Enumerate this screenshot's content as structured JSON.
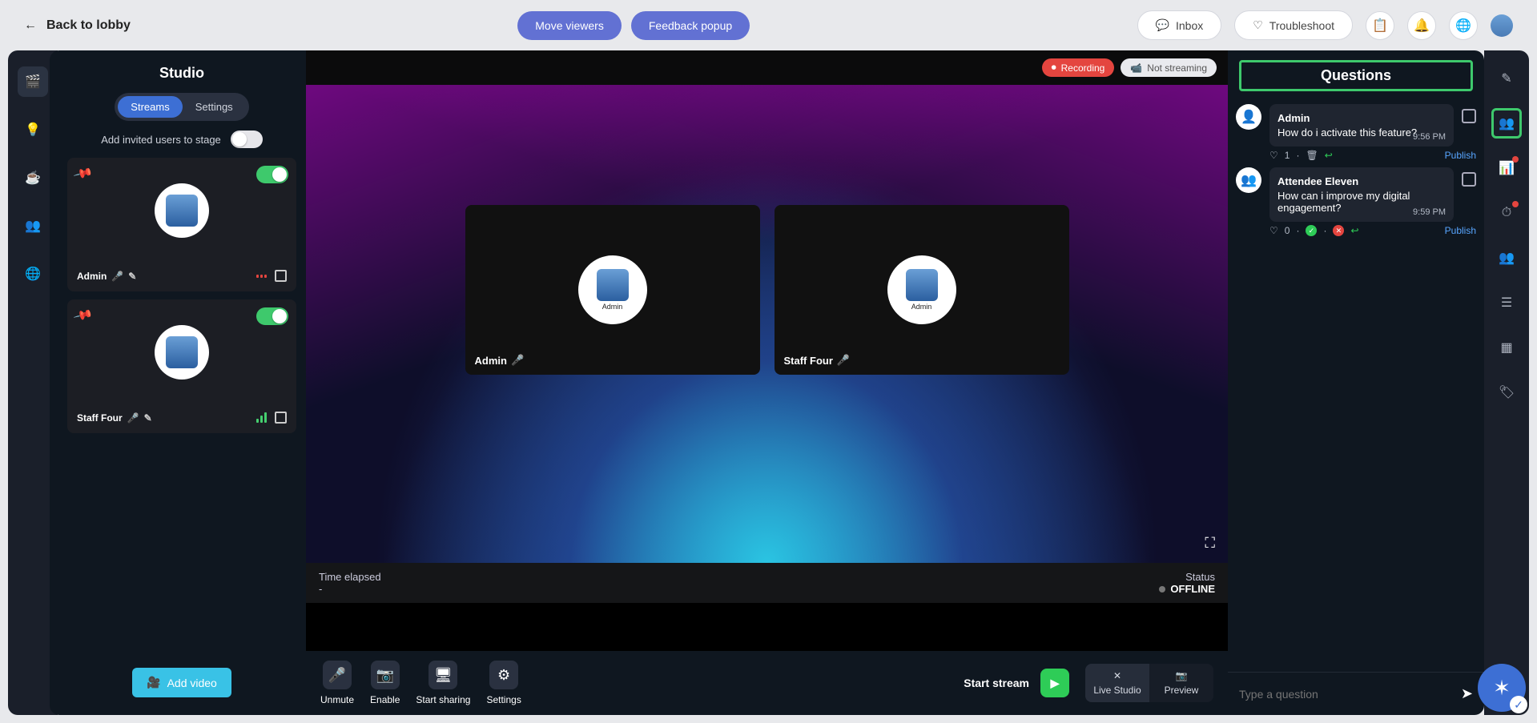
{
  "header": {
    "back_label": "Back to lobby",
    "move_viewers": "Move viewers",
    "feedback_popup": "Feedback popup",
    "inbox": "Inbox",
    "troubleshoot": "Troubleshoot"
  },
  "studio": {
    "title": "Studio",
    "tabs": {
      "streams": "Streams",
      "settings": "Settings"
    },
    "invite_label": "Add invited users to stage",
    "add_video": "Add video",
    "streams": [
      {
        "name": "Admin",
        "signal": "low"
      },
      {
        "name": "Staff Four",
        "signal": "good"
      }
    ]
  },
  "stage": {
    "recording": "Recording",
    "not_streaming": "Not streaming",
    "tiles": [
      {
        "name": "Admin",
        "avatar_label": "Admin"
      },
      {
        "name": "Staff Four",
        "avatar_label": "Admin"
      }
    ],
    "time_elapsed_label": "Time elapsed",
    "time_elapsed_value": "-",
    "status_label": "Status",
    "status_value": "OFFLINE"
  },
  "controls": {
    "unmute": "Unmute",
    "enable": "Enable",
    "start_sharing": "Start sharing",
    "settings": "Settings",
    "start_stream": "Start stream",
    "live_studio": "Live Studio",
    "preview": "Preview"
  },
  "questions": {
    "title": "Questions",
    "placeholder": "Type a question",
    "publish": "Publish",
    "items": [
      {
        "author": "Admin",
        "text": "How do i activate this feature?",
        "time": "9:56 PM",
        "likes": "1",
        "kind": "admin"
      },
      {
        "author": "Attendee Eleven",
        "text": "How can i improve my digital engagement?",
        "time": "9:59 PM",
        "likes": "0",
        "kind": "attendee"
      }
    ]
  }
}
